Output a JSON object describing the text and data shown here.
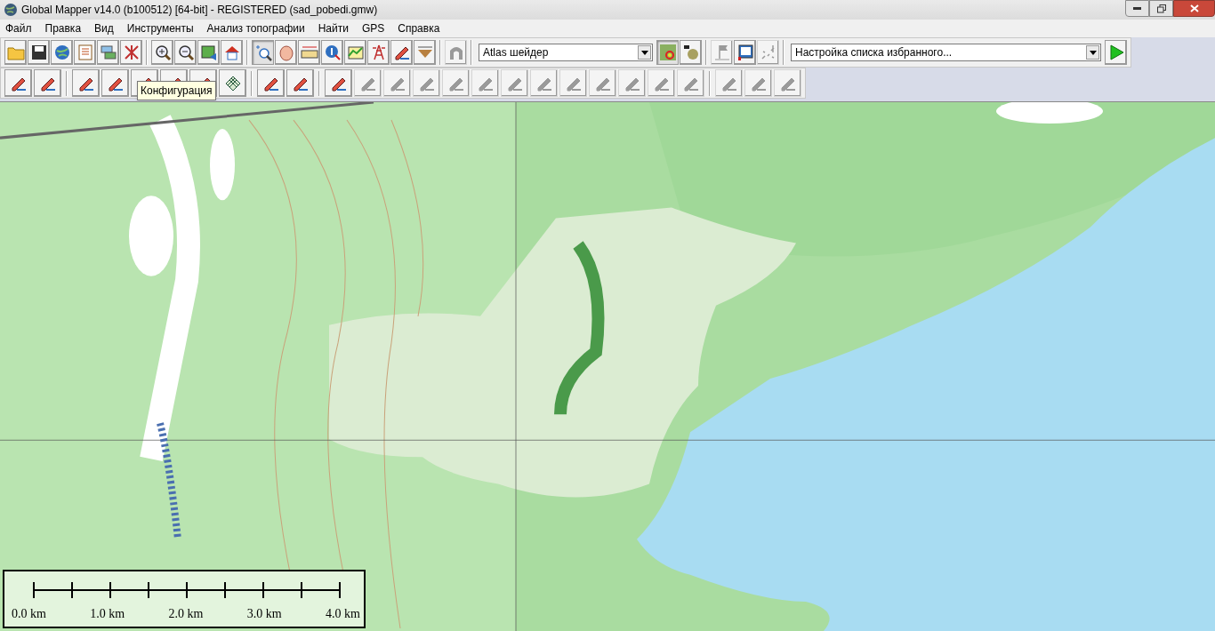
{
  "window": {
    "title": "Global Mapper v14.0 (b100512) [64-bit] - REGISTERED (sad_pobedi.gmw)"
  },
  "menu": [
    "Файл",
    "Правка",
    "Вид",
    "Инструменты",
    "Анализ топографии",
    "Найти",
    "GPS",
    "Справка"
  ],
  "toolbar_1": [
    {
      "kind": "button",
      "disabled": false,
      "pressed": false
    },
    {
      "kind": "button",
      "disabled": false,
      "pressed": false
    },
    {
      "kind": "button",
      "disabled": false,
      "pressed": false
    },
    {
      "kind": "button",
      "disabled": false,
      "pressed": false
    },
    {
      "kind": "button",
      "disabled": false,
      "pressed": false
    },
    {
      "kind": "button",
      "disabled": false,
      "pressed": false
    },
    {
      "kind": "separator"
    },
    {
      "kind": "button",
      "disabled": false,
      "pressed": false
    },
    {
      "kind": "button",
      "disabled": false,
      "pressed": false
    },
    {
      "kind": "button",
      "disabled": false,
      "pressed": false
    },
    {
      "kind": "button",
      "disabled": false,
      "pressed": false
    },
    {
      "kind": "separator"
    },
    {
      "kind": "button",
      "disabled": false,
      "pressed": true
    },
    {
      "kind": "button",
      "disabled": false,
      "pressed": false
    },
    {
      "kind": "button",
      "disabled": false,
      "pressed": false
    },
    {
      "kind": "button",
      "disabled": false,
      "pressed": false
    },
    {
      "kind": "button",
      "disabled": false,
      "pressed": false
    },
    {
      "kind": "button",
      "disabled": false,
      "pressed": false
    },
    {
      "kind": "button",
      "disabled": false,
      "pressed": false
    },
    {
      "kind": "button",
      "disabled": false,
      "pressed": false
    },
    {
      "kind": "separator"
    },
    {
      "kind": "button",
      "disabled": true,
      "pressed": false
    },
    {
      "kind": "separator"
    },
    {
      "kind": "combo",
      "value": "Atlas шейдер"
    },
    {
      "kind": "button",
      "disabled": false,
      "pressed": true
    },
    {
      "kind": "button",
      "disabled": false,
      "pressed": false
    },
    {
      "kind": "separator"
    },
    {
      "kind": "button",
      "disabled": true,
      "pressed": false
    },
    {
      "kind": "button",
      "disabled": false,
      "pressed": false
    },
    {
      "kind": "button",
      "disabled": true,
      "pressed": false
    },
    {
      "kind": "separator"
    },
    {
      "kind": "wide_combo",
      "value": "Настройка списка избранного..."
    },
    {
      "kind": "button",
      "disabled": false,
      "pressed": false
    }
  ],
  "toolbar_2": [
    {
      "kind": "button",
      "disabled": false,
      "pressed": false
    },
    {
      "kind": "button",
      "disabled": false,
      "pressed": false
    },
    {
      "kind": "separator"
    },
    {
      "kind": "button",
      "disabled": false,
      "pressed": false
    },
    {
      "kind": "button",
      "disabled": false,
      "pressed": false
    },
    {
      "kind": "button",
      "disabled": false,
      "pressed": false
    },
    {
      "kind": "button",
      "disabled": false,
      "pressed": false
    },
    {
      "kind": "button",
      "disabled": false,
      "pressed": false
    },
    {
      "kind": "button",
      "disabled": false,
      "pressed": false
    },
    {
      "kind": "separator"
    },
    {
      "kind": "button",
      "disabled": false,
      "pressed": false
    },
    {
      "kind": "button",
      "disabled": false,
      "pressed": false
    },
    {
      "kind": "separator"
    },
    {
      "kind": "button",
      "disabled": false,
      "pressed": false
    },
    {
      "kind": "button",
      "disabled": true,
      "pressed": false
    },
    {
      "kind": "button",
      "disabled": true,
      "pressed": false
    },
    {
      "kind": "button",
      "disabled": true,
      "pressed": false
    },
    {
      "kind": "button",
      "disabled": true,
      "pressed": false
    },
    {
      "kind": "button",
      "disabled": true,
      "pressed": false
    },
    {
      "kind": "button",
      "disabled": true,
      "pressed": false
    },
    {
      "kind": "button",
      "disabled": true,
      "pressed": false
    },
    {
      "kind": "button",
      "disabled": true,
      "pressed": false
    },
    {
      "kind": "button",
      "disabled": true,
      "pressed": false
    },
    {
      "kind": "button",
      "disabled": true,
      "pressed": false
    },
    {
      "kind": "button",
      "disabled": true,
      "pressed": false
    },
    {
      "kind": "button",
      "disabled": true,
      "pressed": false
    },
    {
      "kind": "separator"
    },
    {
      "kind": "button",
      "disabled": true,
      "pressed": false
    },
    {
      "kind": "button",
      "disabled": true,
      "pressed": false
    },
    {
      "kind": "button",
      "disabled": true,
      "pressed": false
    }
  ],
  "tooltip": "Конфигурация",
  "scale_bar": {
    "labels": [
      "0.0 km",
      "1.0 km",
      "2.0 km",
      "3.0 km",
      "4.0 km"
    ]
  }
}
